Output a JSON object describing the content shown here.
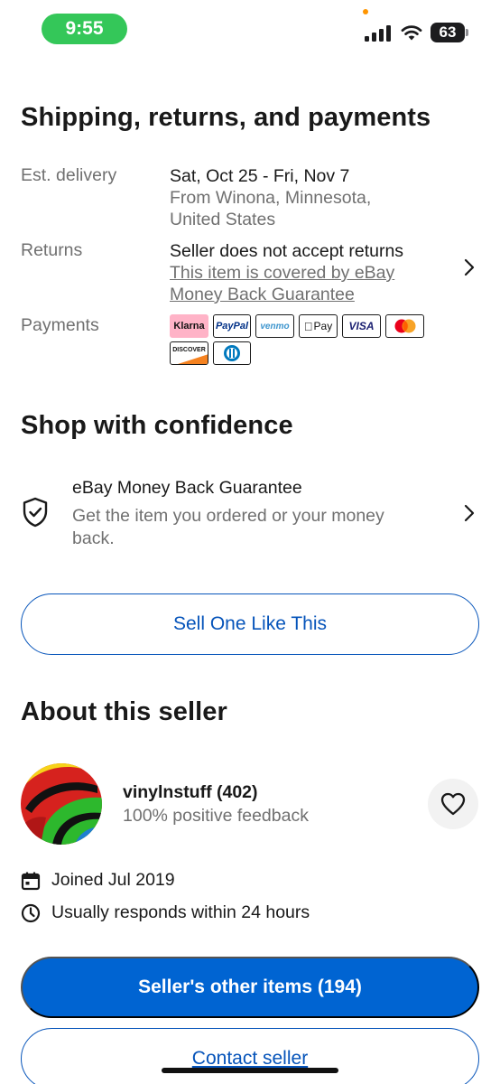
{
  "status_bar": {
    "time": "9:55",
    "battery": "63"
  },
  "shipping": {
    "title": "Shipping, returns, and payments",
    "delivery": {
      "label": "Est. delivery",
      "dates": "Sat, Oct 25 - Fri, Nov 7",
      "origin_line1": "From Winona, Minnesota,",
      "origin_line2": "United States"
    },
    "returns": {
      "label": "Returns",
      "policy": "Seller does not accept returns",
      "link_line1": "This item is covered by eBay",
      "link_line2": "Money Back Guarantee"
    },
    "payments": {
      "label": "Payments",
      "methods": [
        "Klarna",
        "PayPal",
        "venmo",
        "Pay",
        "VISA",
        "Mastercard",
        "DISCOVER",
        "Diners Club"
      ]
    }
  },
  "confidence": {
    "title": "Shop with confidence",
    "guarantee_title": "eBay Money Back Guarantee",
    "guarantee_desc": "Get the item you ordered or your money back."
  },
  "sell_button": "Sell One Like This",
  "seller": {
    "title": "About this seller",
    "name": "vinylnstuff (402)",
    "feedback": "100% positive feedback",
    "joined": "Joined Jul 2019",
    "responds": "Usually responds within 24 hours",
    "other_items_button": "Seller's other items (194)",
    "contact_button": "Contact seller"
  },
  "colors": {
    "accent": "#0064d2",
    "link_blue": "#0654ba",
    "status_green": "#34c759"
  }
}
